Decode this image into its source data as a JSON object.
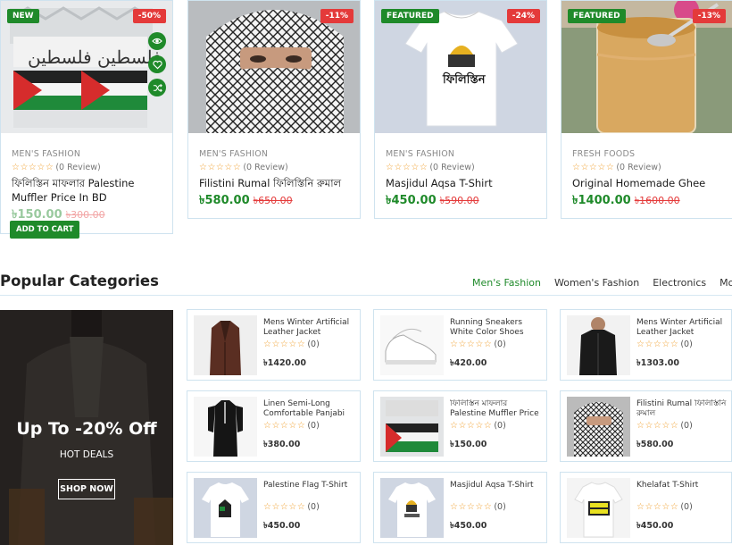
{
  "products": [
    {
      "badge_left": "NEW",
      "badge_right": "-50%",
      "category": "MEN'S FASHION",
      "reviews": "(0 Review)",
      "name": "ফিলিস্তিন মাফলার Palestine Muffler Price In BD",
      "price": "৳150.00",
      "old_price": "৳300.00",
      "add_to_cart": "ADD TO CART"
    },
    {
      "badge_right": "-11%",
      "category": "MEN'S FASHION",
      "reviews": "(0 Review)",
      "name": "Filistini Rumal ফিলিস্তিনি রুমাল",
      "price": "৳580.00",
      "old_price": "৳650.00"
    },
    {
      "badge_left": "FEATURED",
      "badge_right": "-24%",
      "category": "MEN'S FASHION",
      "reviews": "(0 Review)",
      "name": "Masjidul Aqsa T-Shirt",
      "price": "৳450.00",
      "old_price": "৳590.00"
    },
    {
      "badge_left": "FEATURED",
      "badge_right": "-13%",
      "category": "FRESH FOODS",
      "reviews": "(0 Review)",
      "name": "Original Homemade Ghee",
      "price": "৳1400.00",
      "old_price": "৳1600.00"
    }
  ],
  "card_actions": [
    "eye-icon",
    "heart-icon",
    "shuffle-icon"
  ],
  "popular": {
    "title": "Popular Categories",
    "tabs": [
      "Men's Fashion",
      "Women's Fashion",
      "Electronics",
      "Mobile"
    ],
    "active_tab": "Men's Fashion",
    "banner": {
      "title": "Up To -20% Off",
      "subtitle": "HOT DEALS",
      "button": "SHOP NOW"
    },
    "items": [
      {
        "name": "Mens Winter Artificial Leather Jacket",
        "rating": "(0)",
        "price": "৳1420.00"
      },
      {
        "name": "Running Sneakers White Color Shoes",
        "rating": "(0)",
        "price": "৳420.00"
      },
      {
        "name": "Mens Winter Artificial Leather Jacket",
        "rating": "(0)",
        "price": "৳1303.00"
      },
      {
        "name": "Linen Semi-Long Comfortable Panjabi",
        "rating": "(0)",
        "price": "৳380.00"
      },
      {
        "name": "ফিলিস্তিন মাফলার Palestine Muffler Price I...",
        "rating": "(0)",
        "price": "৳150.00"
      },
      {
        "name": "Filistini Rumal ফিলিস্তিনি রুমাল",
        "rating": "(0)",
        "price": "৳580.00"
      },
      {
        "name": "Palestine Flag T-Shirt",
        "rating": "(0)",
        "price": "৳450.00"
      },
      {
        "name": "Masjidul Aqsa T-Shirt",
        "rating": "(0)",
        "price": "৳450.00"
      },
      {
        "name": "Khelafat T-Shirt",
        "rating": "(0)",
        "price": "৳450.00"
      }
    ]
  },
  "colors": {
    "accent": "#1f8a2a",
    "sale": "#e43a3a",
    "star": "#f0a030",
    "border": "#cfe3ef"
  }
}
